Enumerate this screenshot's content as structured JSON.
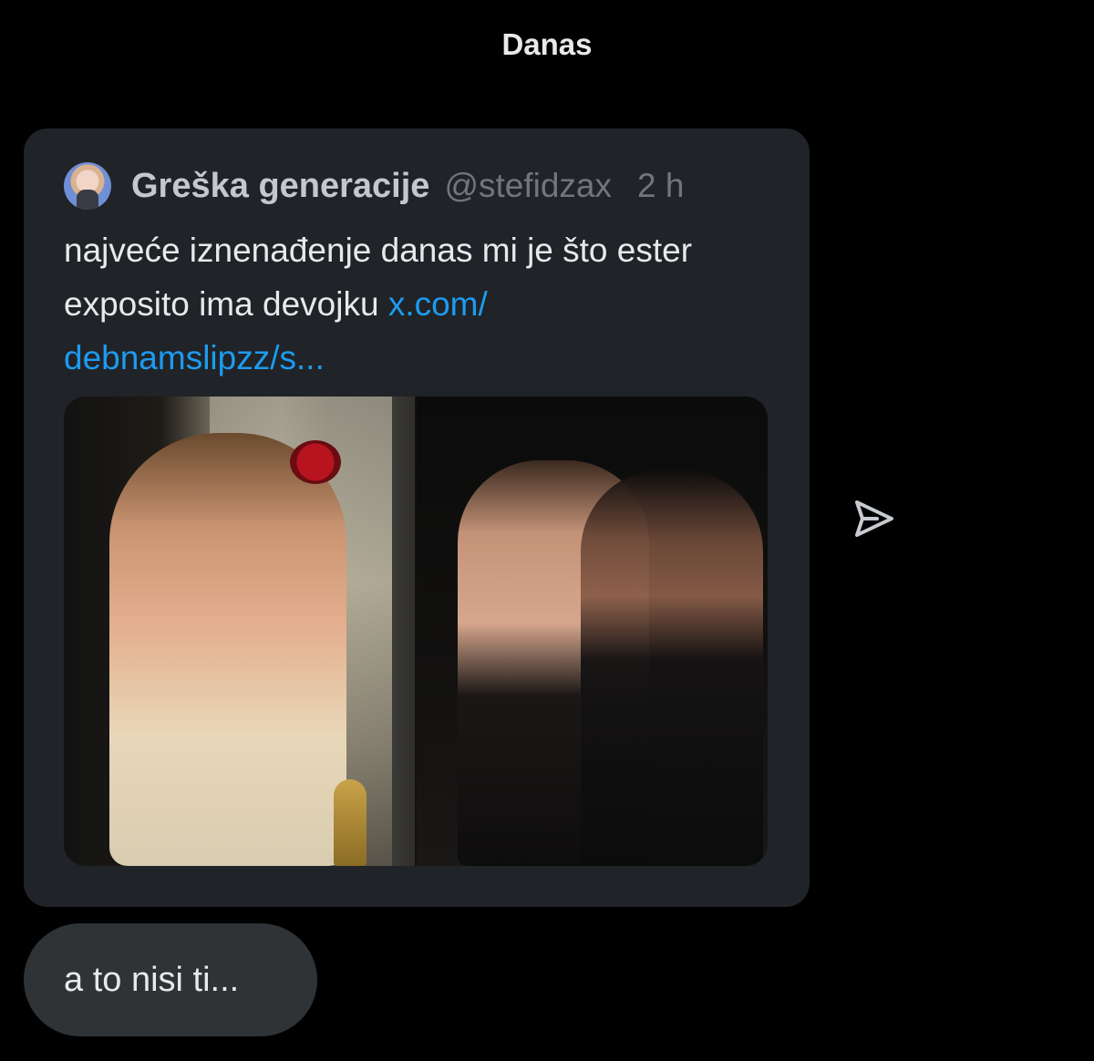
{
  "header": {
    "date_label": "Danas"
  },
  "quoted_tweet": {
    "author_name": "Greška generacije",
    "author_handle": "@stefidzax",
    "time": "2 h",
    "text": "najveće iznenađenje danas mi je što ester exposito ima devojku ",
    "link_text": "x.com/ debnamslipzz/s...",
    "avatar_icon": "profile-avatar",
    "media": {
      "photo_count": 2
    }
  },
  "actions": {
    "share_icon": "send-icon"
  },
  "reply": {
    "text": "a to nisi ti..."
  },
  "colors": {
    "background": "#000000",
    "card": "#202327",
    "bubble": "#2f3336",
    "link": "#1d9bf0",
    "muted": "#71767b",
    "text": "#e7e9ea"
  }
}
